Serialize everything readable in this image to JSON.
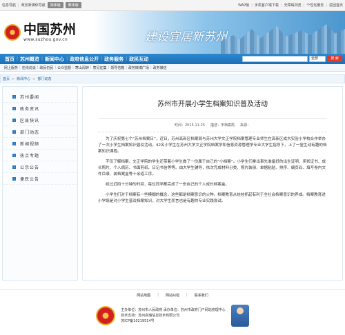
{
  "topbar": {
    "left": [
      "信息导航",
      "政务新媒体导航"
    ],
    "pills": [
      "简体版",
      "繁体版"
    ],
    "right": [
      "WAP版",
      "手机客户端下载",
      "无障碍浏览",
      "个性化服务",
      "返回首页"
    ]
  },
  "banner": {
    "logo_text": "中国苏州",
    "logo_url": "www.suzhou.gov.cn",
    "slogan": "建设宜居新苏州"
  },
  "nav": {
    "items": [
      "首页",
      "苏州概览",
      "新闻中心",
      "政府信息公开",
      "政务服务",
      "政民互动"
    ],
    "search_select": "全部",
    "search_button": "搜 索"
  },
  "subnav": {
    "items": [
      "网上服务",
      "在线访谈",
      "政民仍民",
      "公众监督",
      "寒山闻钟",
      "意见征集",
      "领导信箱",
      "政务微博广场",
      "政务微信"
    ]
  },
  "breadcrumb": [
    "首页",
    "新闻中心",
    "部门动态"
  ],
  "sidebar": {
    "items": [
      "苏州要闻",
      "政务资讯",
      "区县快讯",
      "部门动态",
      "新闻视频",
      "热点专题",
      "公示公告",
      "便民公告"
    ]
  },
  "article": {
    "title": "苏州市开展小学生档案知识普及活动",
    "time_label": "时间：",
    "time": "2015-11-25",
    "source_label": "描述：",
    "source": "市档案局",
    "origin_label": "来源：",
    "origin": "",
    "paragraphs": [
      "为了庆祝第七个“苏州档案日”，近日，苏州高新区档案局与苏州大学文正学院档案管理专业师生在高新区成大实验小学校合作举办了一次小学生档案知识普及活动。42名小学生在苏州大学文正学院档案学和信息资源管理学专业大学生指导下，上了一堂生动有趣的档案知识课程。",
      "不仅了解档案，文正学院的学生还带着小学生做了一份属于自己的“小档案”。小学生们拿出事先准备好的出生证明、奖状证书、成长照片、个人病历、书面剪纸、日记书信等等。由大学生辅导，依次完成材料分类、照片装册、单据粘贴、排序、编页码、填写卷内文件目录、装档案盒等十余道工序。",
      "经过近四十分钟的时间，每位同学都完成了一份自己的个人成长档案盒。",
      "小学生们对于档案有一些模糊的概念，这些都是档案意识的火种。档案教育从娃娃抓起有利于全社会档案意识的养成。档案教育进小学既是对小学生普及档案知识，对大学生而言也是有趣的专业实践尝试。"
    ]
  },
  "footer": {
    "links": [
      "网站地图",
      "网站纠错",
      "联系我们"
    ],
    "lines": [
      "主办单位：苏州市人民政府  承办单位：苏州市政府门户网站管理中心",
      "技术支持：苏州高瑞信息技术有限公司",
      "苏ICP备10219514号"
    ]
  },
  "colors": {
    "nav": "#1a6fb5",
    "accent": "#e03a2a"
  }
}
